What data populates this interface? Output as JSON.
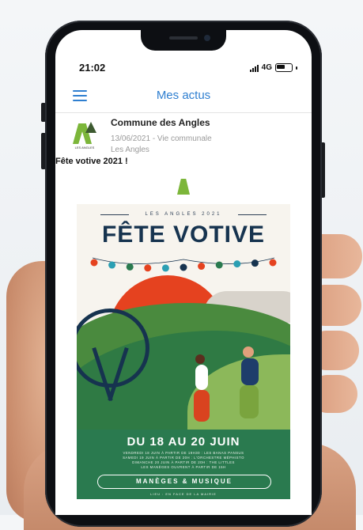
{
  "status_bar": {
    "time": "21:02",
    "network": "4G"
  },
  "app_bar": {
    "title": "Mes actus"
  },
  "post": {
    "organization": "Commune des Angles",
    "logo_text": "LES ANGLES",
    "meta": "13/06/2021 - Vie communale",
    "location": "Les Angles",
    "title": "Fête votive 2021 !"
  },
  "poster": {
    "subtitle": "LES ANGLES 2021",
    "title": "FÊTE VOTIVE",
    "dates": "DU 18 AU 20 JUIN",
    "lines": [
      "VENDREDI 18 JUIN À PARTIR DE 19H30 : LES BANAS PANSUS",
      "SAMEDI 19 JUIN À PARTIR DE 20H : L'ORCHESTRE MÉPHISTO",
      "DIMANCHE 20 JUIN À PARTIR DE 20H : THE LITTLES",
      "LES MANÈGES OUVRENT À PARTIR DE 15H"
    ],
    "banner": "MANÈGES & MUSIQUE",
    "footer": "LIEU : EN FACE DE LA MAIRIE",
    "garland_colors": [
      "#e5421f",
      "#2b9fb3",
      "#2a7a4f",
      "#e5421f",
      "#2b9fb3",
      "#16334f",
      "#e5421f",
      "#2a7a4f",
      "#2b9fb3",
      "#16334f",
      "#e5421f"
    ]
  },
  "colors": {
    "accent": "#2f7fd0",
    "poster_navy": "#16334f",
    "poster_orange": "#e5421f",
    "poster_green": "#2a7a4f"
  },
  "icons": [
    "menu-icon",
    "signal-icon",
    "battery-icon",
    "commune-logo"
  ]
}
